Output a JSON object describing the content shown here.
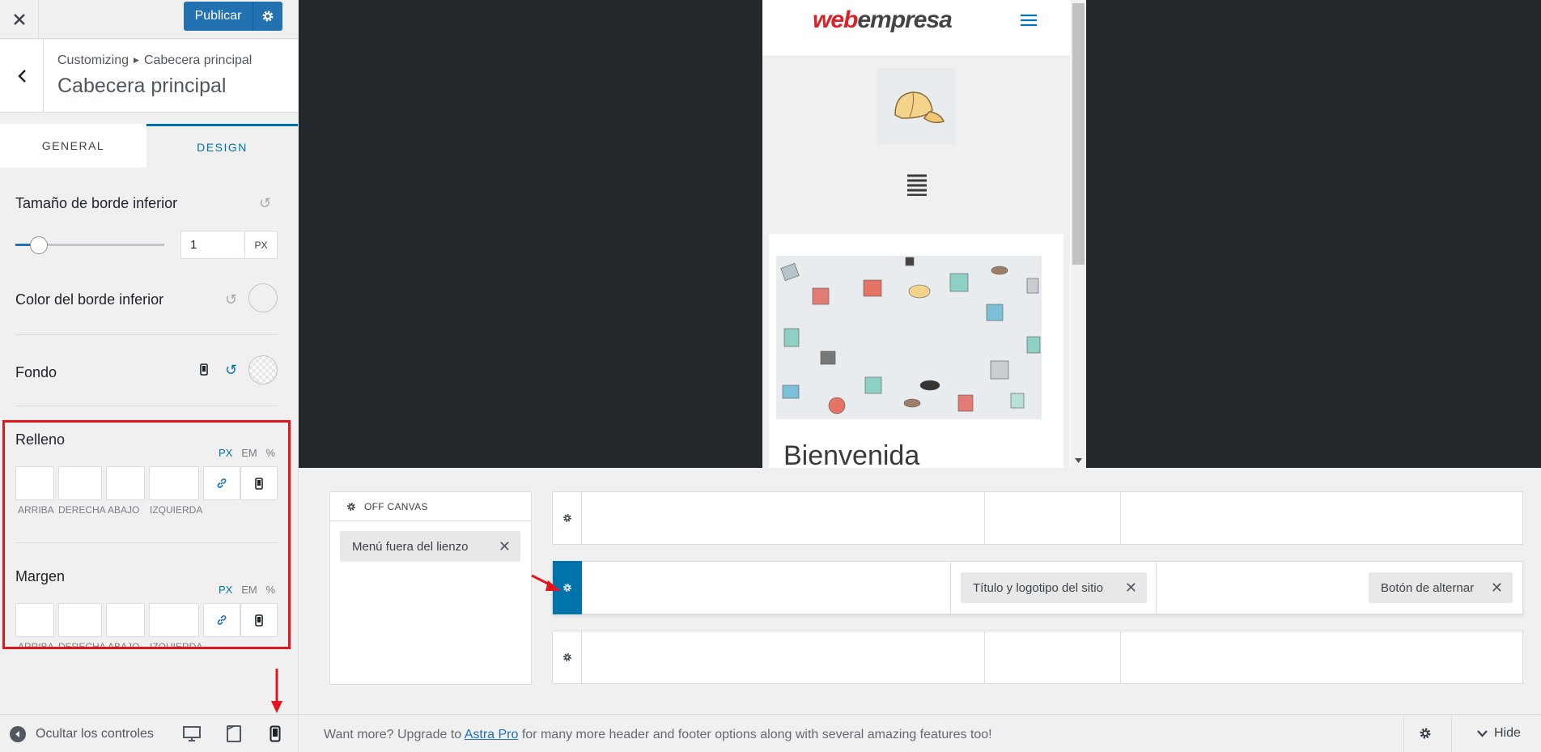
{
  "topbar": {
    "publish_label": "Publicar"
  },
  "header": {
    "breadcrumb_root": "Customizing",
    "breadcrumb_current": "Cabecera principal",
    "title": "Cabecera principal"
  },
  "tabs": [
    {
      "label": "GENERAL"
    },
    {
      "label": "DESIGN"
    }
  ],
  "design": {
    "border_size_label": "Tamaño de borde inferior",
    "border_size_value": "1",
    "border_size_unit": "PX",
    "border_color_label": "Color del borde inferior",
    "background_label": "Fondo",
    "padding": {
      "label": "Relleno",
      "units": [
        "PX",
        "EM",
        "%"
      ],
      "fields": [
        "ARRIBA",
        "DERECHA",
        "ABAJO",
        "IZQUIERDA"
      ]
    },
    "margin": {
      "label": "Margen",
      "units": [
        "PX",
        "EM",
        "%"
      ],
      "fields": [
        "ARRIBA",
        "DERECHA",
        "ABAJO",
        "IZQUIERDA"
      ]
    }
  },
  "bottombar": {
    "hide_controls_label": "Ocultar los controles"
  },
  "preview": {
    "logo_part1": "web",
    "logo_part2": "empresa",
    "welcome": "Bienvenida"
  },
  "builder": {
    "offcanvas_title": "OFF CANVAS",
    "offcanvas_item": "Menú fuera del lienzo",
    "chip_site_title": "Título y logotipo del sitio",
    "chip_toggle": "Botón de alternar"
  },
  "footer": {
    "upgrade_pre": "Want more? Upgrade to ",
    "upgrade_link": "Astra Pro",
    "upgrade_post": " for many more header and footer options along with several amazing features too!",
    "hide_label": "Hide"
  },
  "colors": {
    "accent": "#2271b1",
    "active_tab": "#0073aa",
    "highlight": "#e3161e",
    "brand_red": "#d8232a"
  }
}
